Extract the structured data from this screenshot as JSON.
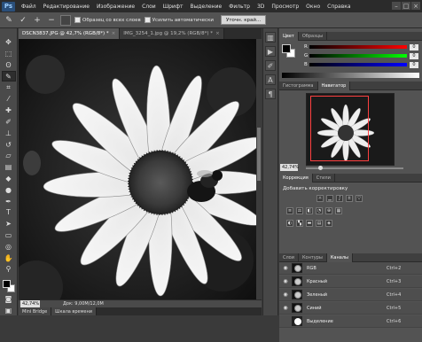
{
  "app": {
    "logo": "Ps"
  },
  "menubar": {
    "items": [
      "Файл",
      "Редактирование",
      "Изображение",
      "Слои",
      "Шрифт",
      "Выделение",
      "Фильтр",
      "3D",
      "Просмотр",
      "Окно",
      "Справка"
    ]
  },
  "options": {
    "sample_all_label": "Образец со всех слоев",
    "auto_enhance_label": "Усилить автоматически",
    "refine_label": "Уточн. край..."
  },
  "documents": {
    "tabs": [
      {
        "label": "DSCN3837.JPG @ 42,7% (RGB/8*) *",
        "close": "×"
      },
      {
        "label": "IMG_3254_1.jpg @ 19,2% (RGB/8*) *",
        "close": "×"
      }
    ]
  },
  "status": {
    "zoom": "42,74%",
    "doc_info": "Док: 9,00М/12,0М"
  },
  "bottom_tabs": [
    "Mini Bridge",
    "Шкала времени"
  ],
  "color_panel": {
    "tabs": [
      "Цвет",
      "Образцы"
    ],
    "channels": [
      {
        "label": "R",
        "value": "0"
      },
      {
        "label": "G",
        "value": "0"
      },
      {
        "label": "B",
        "value": "0"
      }
    ]
  },
  "navigator": {
    "tabs": [
      "Гистограмма",
      "Навигатор"
    ],
    "zoom": "42,74%"
  },
  "adjustments": {
    "tabs": [
      "Коррекция",
      "Стили"
    ],
    "title": "Добавить корректировку"
  },
  "layers": {
    "tabs": [
      "Слои",
      "Контуры",
      "Каналы"
    ],
    "channels": [
      {
        "name": "RGB",
        "shortcut": "Ctrl+2"
      },
      {
        "name": "Красный",
        "shortcut": "Ctrl+3"
      },
      {
        "name": "Зеленый",
        "shortcut": "Ctrl+4"
      },
      {
        "name": "Синий",
        "shortcut": "Ctrl+5"
      },
      {
        "name": "Выделение",
        "shortcut": "Ctrl+6"
      }
    ]
  }
}
